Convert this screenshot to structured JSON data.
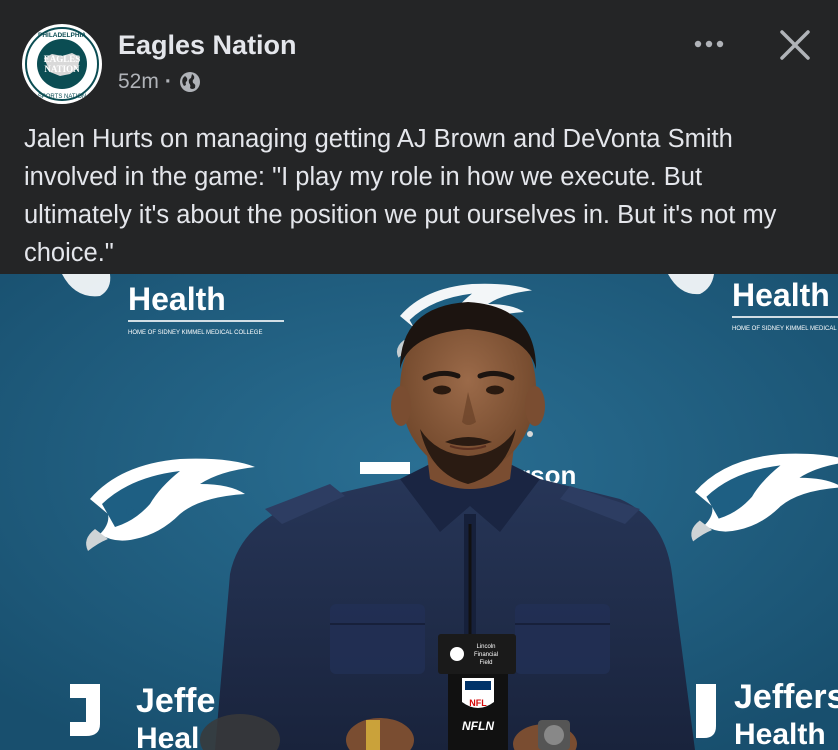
{
  "post": {
    "author": "Eagles Nation",
    "time": "52m",
    "separator": "·",
    "privacy_icon": "globe-icon",
    "more_icon": "ellipsis-icon",
    "close_icon": "close-icon",
    "text": "Jalen Hurts on managing getting AJ Brown and DeVonta Smith involved in the game: \"I play my role in how we execute. But ultimately it's about the position we put ourselves in. But it's not my choice.\""
  },
  "avatar_logo": {
    "top_text": "PHILADELPHIA",
    "line1": "EAGLES",
    "line2": "NATION",
    "bottom_text": "SPORTS NATION"
  },
  "photo": {
    "backdrop_sponsor": "Health",
    "backdrop_sponsor_sub": "HOME OF SIDNEY KIMMEL MEDICAL COLLEGE",
    "backdrop_left_bottom": "Jeffe",
    "backdrop_left_bottom2": "Heal",
    "backdrop_right_bottom": "Jeffers",
    "backdrop_right_bottom2": "Health",
    "backdrop_center": "rson",
    "mic_flag_line1": "Lincoln",
    "mic_flag_line2": "Financial",
    "mic_flag_line3": "Field",
    "mic_nfl": "NFL",
    "mic_network": "NFLN",
    "colors": {
      "backdrop": "#1e5f83",
      "jacket": "#1f2d4a",
      "skin": "#8a5a3c"
    }
  }
}
